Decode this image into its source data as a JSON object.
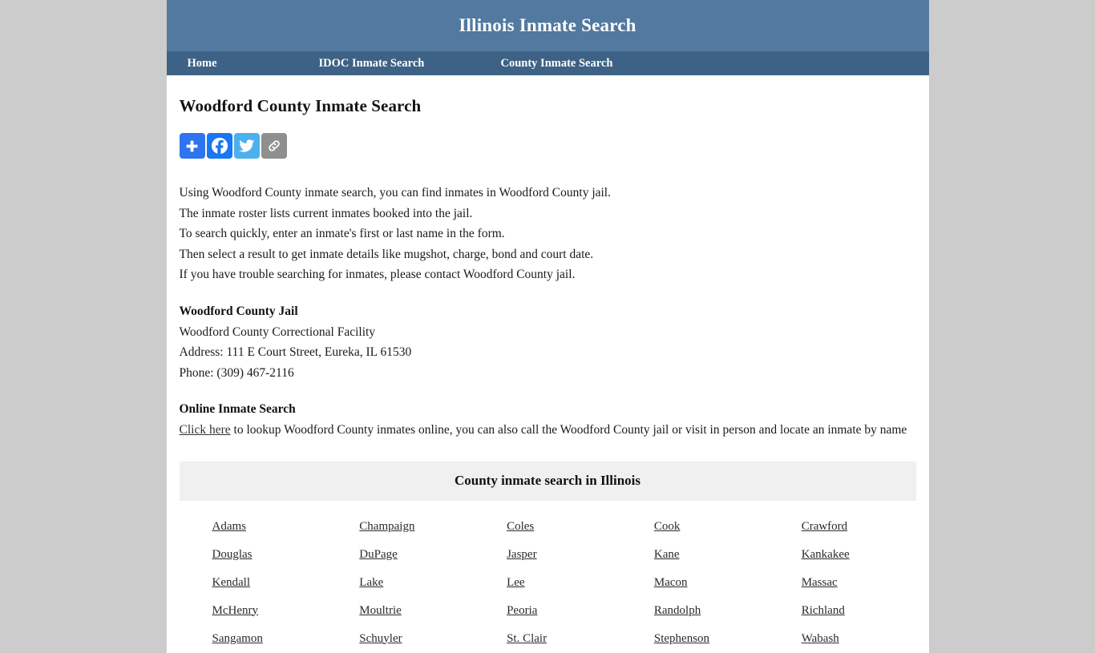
{
  "header": {
    "site_title": "Illinois Inmate Search",
    "brand_color": "#52799f",
    "nav_color": "#3d6285"
  },
  "nav": {
    "items": [
      {
        "label": "Home",
        "name": "nav-item-home"
      },
      {
        "label": "IDOC Inmate Search",
        "name": "nav-item-idoc-inmate-search"
      },
      {
        "label": "County Inmate Search",
        "name": "nav-item-county-inmate-search"
      }
    ]
  },
  "main": {
    "page_title": "Woodford County Inmate Search",
    "share": {
      "buttons": [
        {
          "label": "Share",
          "icon": "plus-icon",
          "color": "#2e73f0"
        },
        {
          "label": "Facebook",
          "icon": "facebook-icon",
          "color": "#1877f2"
        },
        {
          "label": "Twitter",
          "icon": "twitter-icon",
          "color": "#4db0ee"
        },
        {
          "label": "Copy Link",
          "icon": "link-icon",
          "color": "#8f8f8f"
        }
      ]
    },
    "intro_lines": [
      "Using Woodford County inmate search, you can find inmates in Woodford County jail.",
      "The inmate roster lists current inmates booked into the jail.",
      "To search quickly, enter an inmate's first or last name in the form.",
      "Then select a result to get inmate details like mugshot, charge, bond and court date.",
      "If you have trouble searching for inmates, please contact Woodford County jail."
    ],
    "jail": {
      "heading": "Woodford County Jail",
      "facility": "Woodford County Correctional Facility",
      "address": "Address: 111 E Court Street, Eureka, IL 61530",
      "phone": "Phone: (309) 467-2116"
    },
    "online_search": {
      "heading": "Online Inmate Search",
      "link_text": "Click here",
      "body_text": " to lookup Woodford County inmates online, you can also call the Woodford County jail or visit in person and locate an inmate by name"
    },
    "county_table": {
      "caption": "County inmate search in Illinois",
      "rows": [
        [
          "Adams",
          "Champaign",
          "Coles",
          "Cook",
          "Crawford"
        ],
        [
          "Douglas",
          "DuPage",
          "Jasper",
          "Kane",
          "Kankakee"
        ],
        [
          "Kendall",
          "Lake",
          "Lee",
          "Macon",
          "Massac"
        ],
        [
          "McHenry",
          "Moultrie",
          "Peoria",
          "Randolph",
          "Richland"
        ],
        [
          "Sangamon",
          "Schuyler",
          "St. Clair",
          "Stephenson",
          "Wabash"
        ]
      ]
    }
  }
}
